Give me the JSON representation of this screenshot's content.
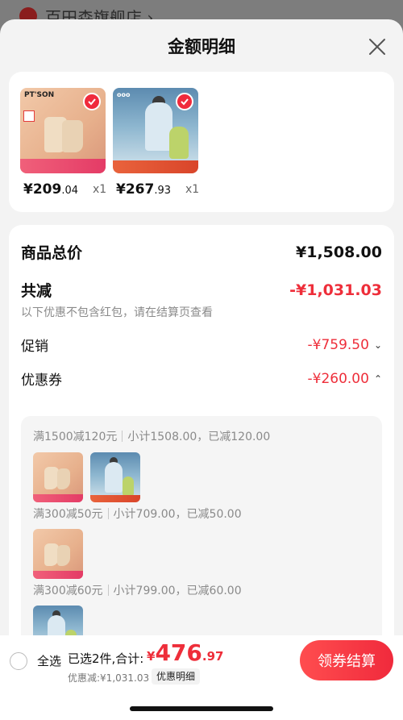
{
  "background": {
    "store_title": "百田森旗舰店 ›"
  },
  "sheet": {
    "title": "金额明细"
  },
  "products": [
    {
      "brand": "PT'SON",
      "price_int": "¥209",
      "price_dec": ".04",
      "qty": "x1"
    },
    {
      "brand": "",
      "price_int": "¥267",
      "price_dec": ".93",
      "qty": "x1"
    }
  ],
  "summary": {
    "total_label": "商品总价",
    "total_value": "¥1,508.00",
    "reduce_label": "共减",
    "reduce_value": "-¥1,031.03",
    "note": "以下优惠不包含红包，请在结算页查看",
    "promo_label": "促销",
    "promo_value": "-¥759.50",
    "coupon_label": "优惠券",
    "coupon_value": "-¥260.00"
  },
  "coupons": [
    {
      "rule": "满1500减120元",
      "detail": "小计1508.00，已减120.00"
    },
    {
      "rule": "满300减50元",
      "detail": "小计709.00，已减50.00"
    },
    {
      "rule": "满300减60元",
      "detail": "小计799.00，已减60.00"
    }
  ],
  "bottom": {
    "select_all": "全选",
    "selected_info": "已选2件,合计:",
    "yen": "¥",
    "total_int": "476",
    "total_dec": ".97",
    "discount": "优惠减:¥1,031.03",
    "detail_tag": "优惠明细",
    "checkout": "领券结算"
  },
  "colors": {
    "accent_red": "#ee2e3a",
    "sheet_bg": "#f3f3f3"
  }
}
